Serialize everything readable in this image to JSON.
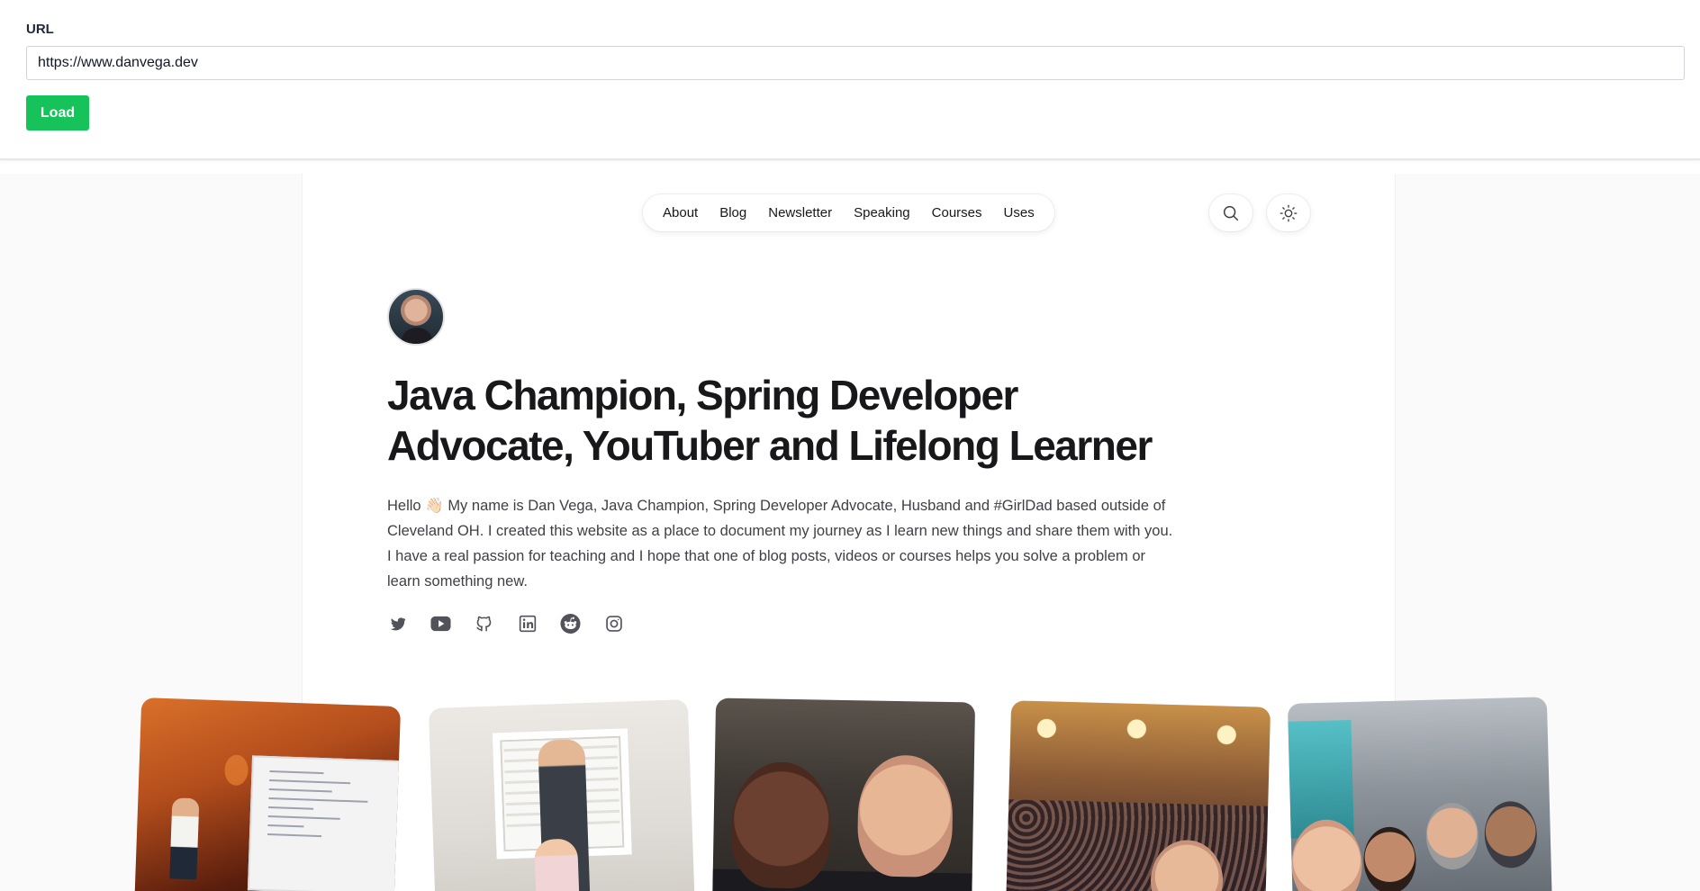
{
  "toolbar": {
    "url_label": "URL",
    "url_value": "https://www.danvega.dev",
    "load_label": "Load",
    "load_color": "#16c25a"
  },
  "nav": {
    "items": [
      {
        "label": "About"
      },
      {
        "label": "Blog"
      },
      {
        "label": "Newsletter"
      },
      {
        "label": "Speaking"
      },
      {
        "label": "Courses"
      },
      {
        "label": "Uses"
      }
    ],
    "search_icon": "search-icon",
    "theme_icon": "sun-icon"
  },
  "hero": {
    "headline": "Java Champion, Spring Developer Advocate, YouTuber and Lifelong Learner",
    "bio": "Hello 👋🏻 My name is Dan Vega, Java Champion, Spring Developer Advocate, Husband and #GirlDad based outside of Cleveland OH. I created this website as a place to document my journey as I learn new things and share them with you. I have a real passion for teaching and I hope that one of blog posts, videos or courses helps you solve a problem or learn something new."
  },
  "socials": [
    "twitter-icon",
    "youtube-icon",
    "github-icon",
    "linkedin-icon",
    "reddit-icon",
    "instagram-icon"
  ],
  "photos": [
    "conference-talk-photo",
    "father-daughter-photo",
    "selfie-photo",
    "ballroom-selfie-photo",
    "expo-group-photo"
  ]
}
